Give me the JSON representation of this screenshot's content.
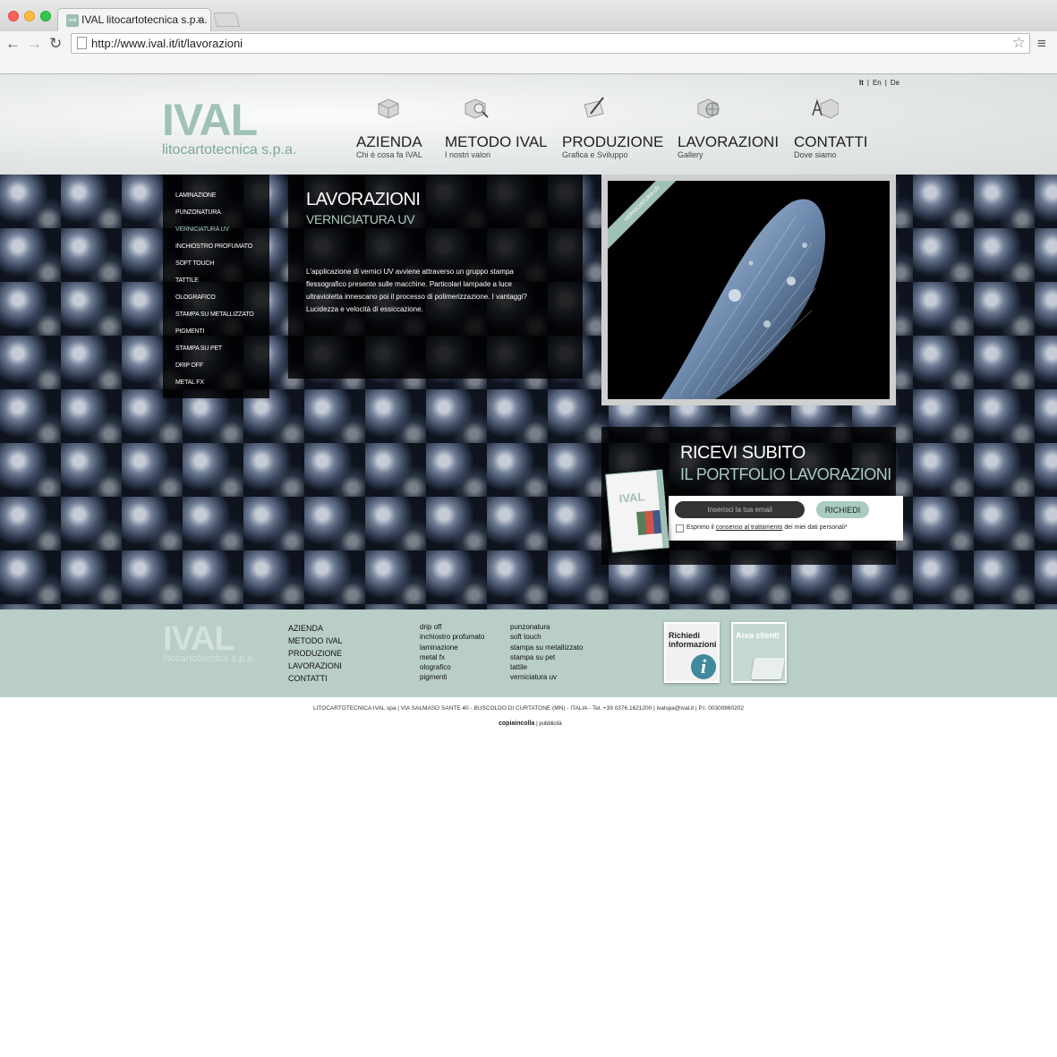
{
  "browser": {
    "tab_title": "IVAL litocartotecnica s.p.a.",
    "tab_close": "×",
    "favicon_text": "ival",
    "url": "http://www.ival.it/it/lavorazioni",
    "back_icon": "←",
    "forward_icon": "→",
    "reload_icon": "↻",
    "star_icon": "☆",
    "menu_icon": "≡"
  },
  "header": {
    "languages": [
      "It",
      "En",
      "De"
    ],
    "active_language": "It",
    "lang_separator": "|",
    "logo": {
      "word": "IVAL",
      "sub": "litocartotecnica s.p.a."
    },
    "nav": [
      {
        "label": "AZIENDA",
        "sub": "Chi è cosa fa IVAL",
        "icon": "box-icon"
      },
      {
        "label": "METODO IVAL",
        "sub": "I nostri valori",
        "icon": "magnifier-box-icon"
      },
      {
        "label": "PRODUZIONE",
        "sub": "Grafica e Sviluppo",
        "icon": "pen-paper-icon"
      },
      {
        "label": "LAVORAZIONI",
        "sub": "Gallery",
        "icon": "globe-box-icon"
      },
      {
        "label": "CONTATTI",
        "sub": "Dove siamo",
        "icon": "letters-box-icon"
      }
    ]
  },
  "side_menu": {
    "items": [
      "LAMINAZIONE",
      "PUNZONATURA",
      "VERNICIATURA UV",
      "INCHIOSTRO PROFUMATO",
      "SOFT TOUCH",
      "TATTILE",
      "OLOGRAFICO",
      "STAMPA SU METALLIZZATO",
      "PIGMENTI",
      "STAMPA SU PET",
      "DRIP OFF",
      "METAL FX"
    ],
    "active": "VERNICIATURA UV"
  },
  "content": {
    "title": "LAVORAZIONI",
    "subtitle": "VERNICIATURA UV",
    "text": "L'applicazione di vernici UV avviene attraverso un gruppo stampa flessografico presente sulle macchine. Particolari lampade a luce ultravioletta innescano poi il processo di polimerizzazione. I vantaggi? Lucidezza e velocità di essiccazione."
  },
  "photo": {
    "ribbon": "VERNICIATURA UV"
  },
  "cta": {
    "line1": "RICEVI SUBITO",
    "line2": "IL PORTFOLIO LAVORAZIONI",
    "email_placeholder": "Inserisci la tua email",
    "submit": "RICHIEDI",
    "consent_pre": "Esprimo il",
    "consent_link": "consenso al trattamento",
    "consent_post": "dei miei dati personali*",
    "brochure_logo": "IVAL"
  },
  "footer": {
    "logo_word": "IVAL",
    "logo_sub": "litocartotecnica s.p.a.",
    "main_links": [
      "AZIENDA",
      "METODO IVAL",
      "PRODUZIONE",
      "LAVORAZIONI",
      "CONTATTI"
    ],
    "col2": [
      "drip off",
      "inchiostro profumato",
      "laminazione",
      "metal fx",
      "olografico",
      "pigmenti"
    ],
    "col3": [
      "punzonatura",
      "soft touch",
      "stampa su metallizzato",
      "stampa su pet",
      "tattile",
      "verniciatura uv"
    ],
    "card_info": "Richiedi informazioni",
    "card_info_icon": "i",
    "card_area": "Area clienti"
  },
  "company_line": "LITOCARTOTECNICA IVAL spa | VIA SALMASO SANTE 40 - BUSCOLDO DI CURTATONE (MN) - ITALIA - Tel. +39 0376.1621200 | ivalspa@ival.it | P.I. 00300860202",
  "credit": {
    "brand": "copiaincolla",
    "separator": "|",
    "sub": "pubblicità"
  },
  "colors": {
    "accent": "#9fc1b7",
    "footer_bg": "#b8cec7",
    "panel_bg": "#000000"
  }
}
